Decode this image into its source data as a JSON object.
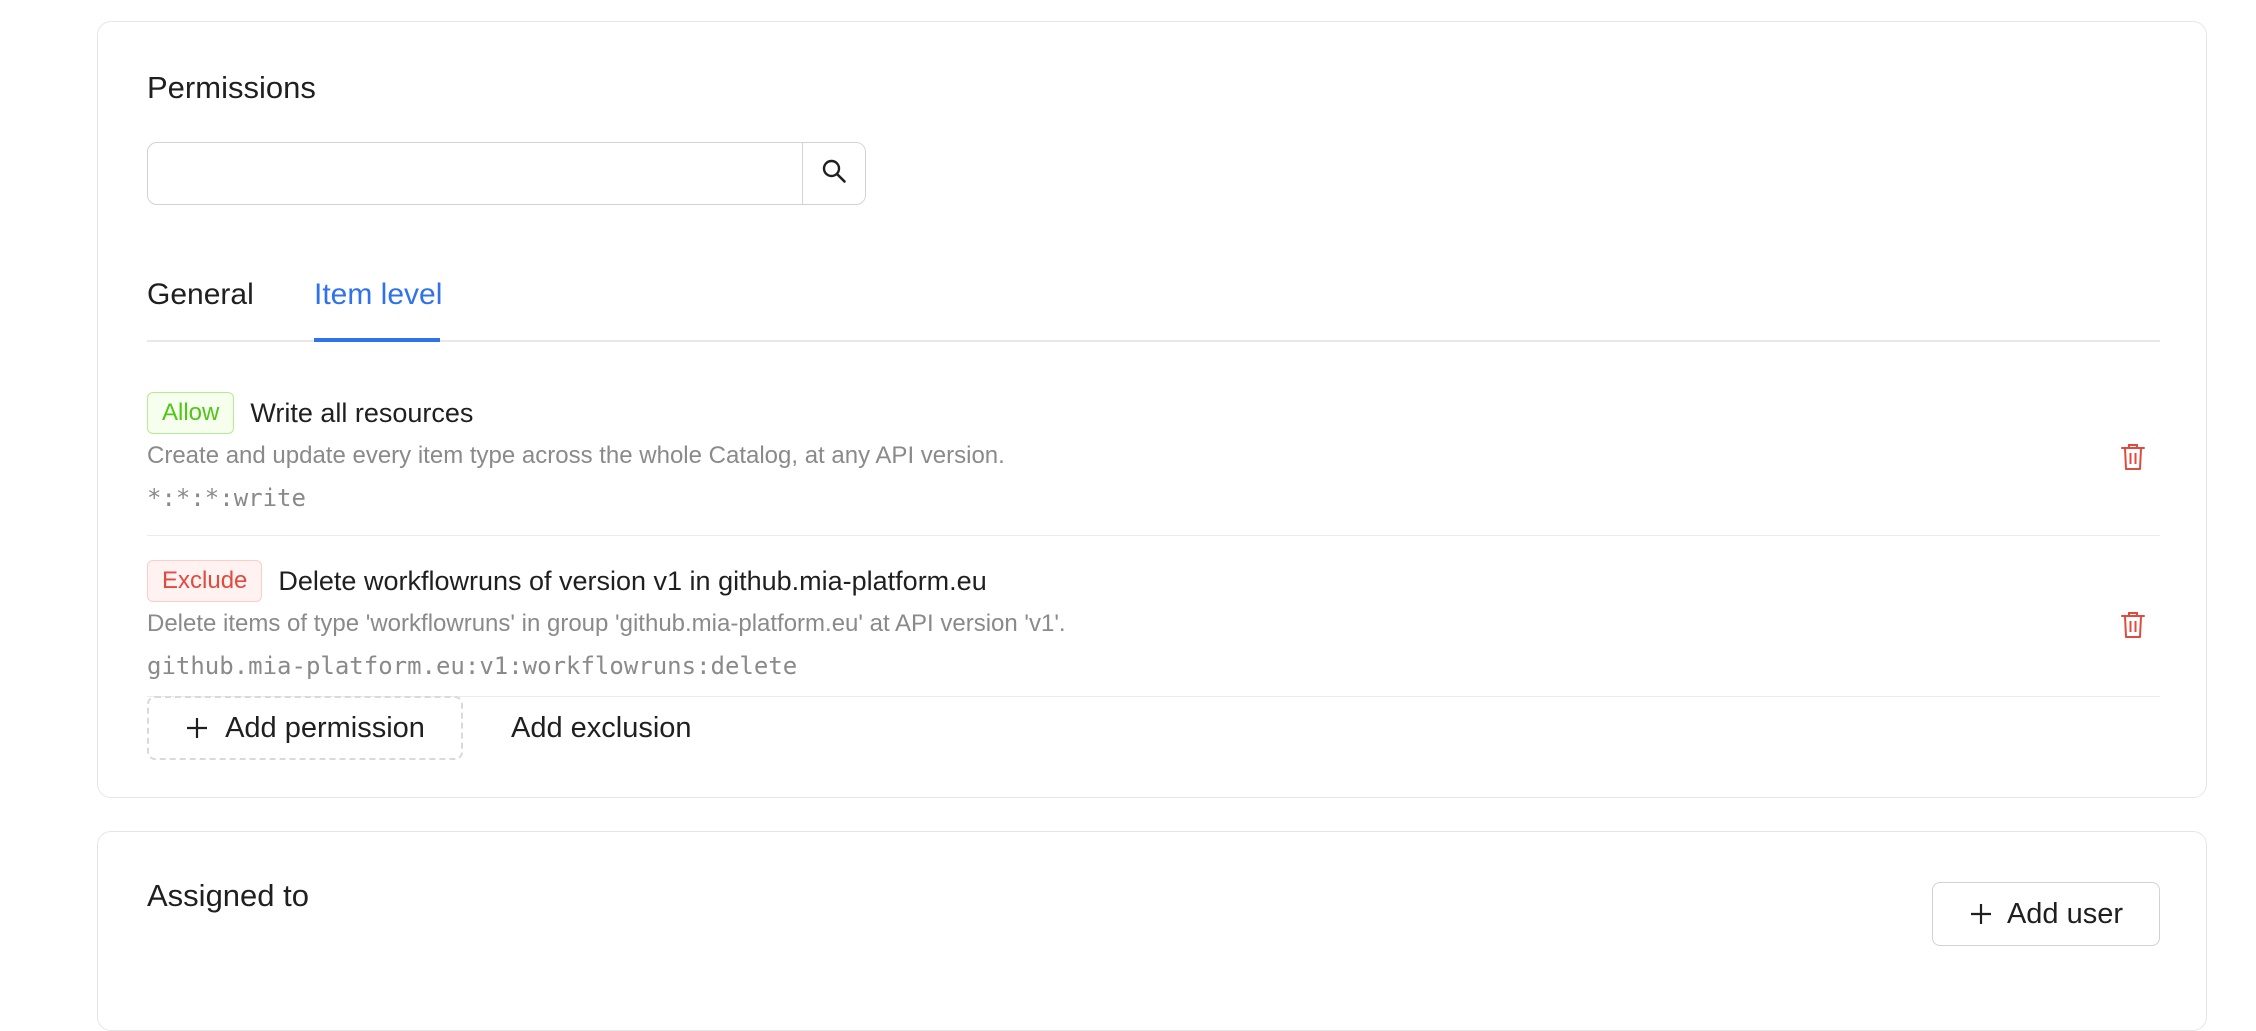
{
  "permissions": {
    "title": "Permissions",
    "search": {
      "value": "",
      "placeholder": ""
    },
    "tabs": [
      {
        "label": "General",
        "active": false
      },
      {
        "label": "Item level",
        "active": true
      }
    ],
    "items": [
      {
        "effect": "Allow",
        "name": "Write all resources",
        "description": "Create and update every item type across the whole Catalog, at any API version.",
        "code": "*:*:*:write"
      },
      {
        "effect": "Exclude",
        "name": "Delete workflowruns of version v1 in github.mia-platform.eu",
        "description": "Delete items of type 'workflowruns' in group 'github.mia-platform.eu' at API version 'v1'.",
        "code": "github.mia-platform.eu:v1:workflowruns:delete"
      }
    ],
    "add_permission_label": "Add permission",
    "add_exclusion_label": "Add exclusion"
  },
  "assigned": {
    "title": "Assigned to",
    "add_user_label": "Add user"
  },
  "colors": {
    "accent": "#2f72ea",
    "allow": "#52c41a",
    "exclude": "#e04a3f",
    "delete_icon": "#e04a3f"
  },
  "icons": {
    "search": "search-icon",
    "delete": "trash-icon",
    "add": "plus-icon"
  }
}
